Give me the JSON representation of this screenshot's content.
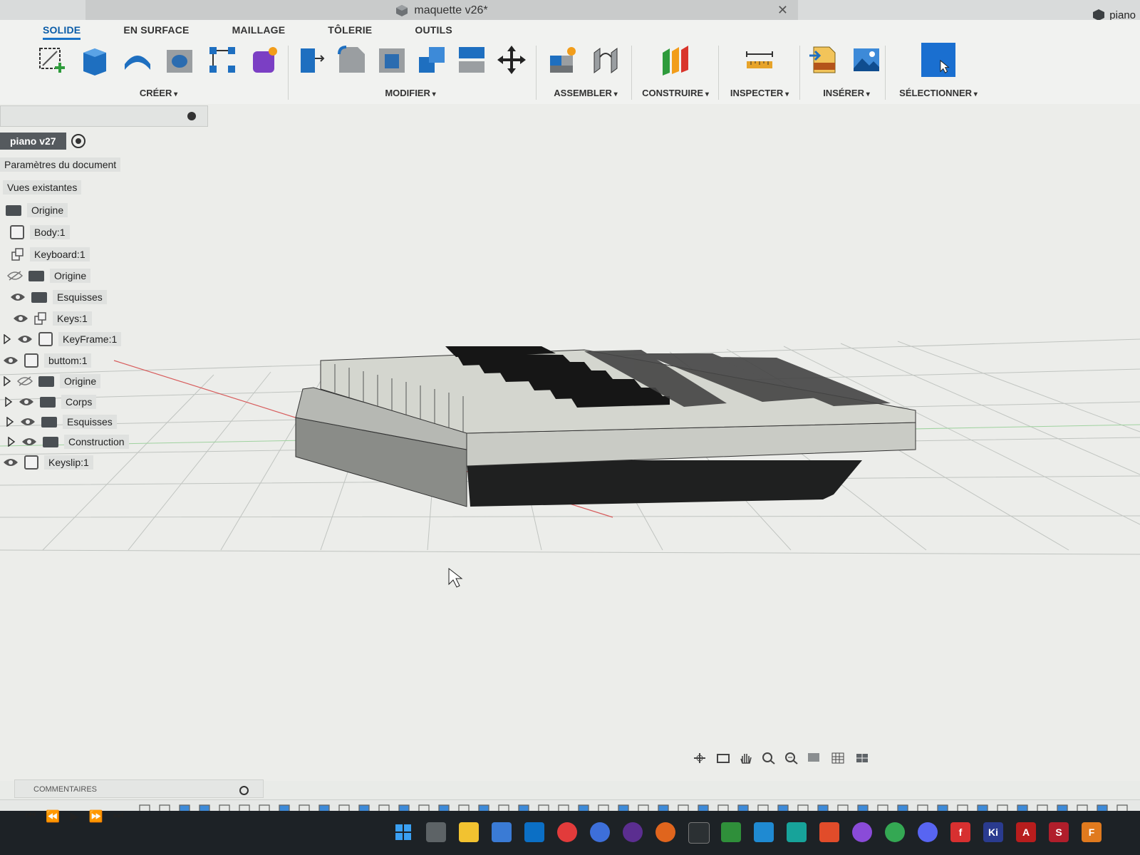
{
  "window": {
    "title": "maquette v26*",
    "close": "✕",
    "user": "piano"
  },
  "ribbon": {
    "tabs": [
      "SOLIDE",
      "EN SURFACE",
      "MAILLAGE",
      "TÔLERIE",
      "OUTILS"
    ],
    "active_tab": "SOLIDE",
    "groups": {
      "creer": "CRÉER",
      "modifier": "MODIFIER",
      "assembler": "ASSEMBLER",
      "construire": "CONSTRUIRE",
      "inspecter": "INSPECTER",
      "inserer": "INSÉRER",
      "selectionner": "SÉLECTIONNER"
    }
  },
  "browser": {
    "root": "piano v27",
    "items": [
      "Paramètres du document",
      "Vues existantes",
      "Origine",
      "Body:1",
      "Keyboard:1",
      "Origine",
      "Esquisses",
      "Keys:1",
      "KeyFrame:1",
      "buttom:1",
      "Origine",
      "Corps",
      "Esquisses",
      "Construction",
      "Keyslip:1"
    ]
  },
  "comments": {
    "label": "COMMENTAIRES"
  },
  "taskbar": {
    "letters": {
      "flash": "f",
      "kicad": "Ki",
      "acrobat": "A",
      "siv": "S",
      "fusion": "F"
    }
  },
  "colors": {
    "accent": "#1a73c8",
    "model_light": "#d4d6cf",
    "model_dark": "#1f2020",
    "grid": "#b8bcb8"
  }
}
